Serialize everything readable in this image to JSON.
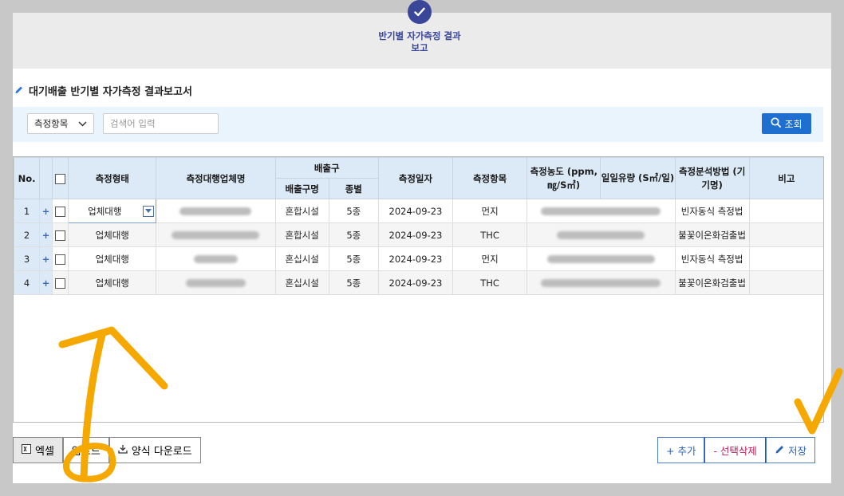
{
  "step": {
    "label": "반기별 자가측정 결과보고",
    "icon": "check-icon"
  },
  "section": {
    "title": "대기배출 반기별 자가측정 결과보고서",
    "icon": "pencil-icon"
  },
  "search": {
    "item_select_value": "측정항목",
    "placeholder": "검색어 입력",
    "button_label": "조회"
  },
  "table": {
    "headers": {
      "no": "No.",
      "type": "측정형태",
      "agency": "측정대행업체명",
      "outlet_group": "배출구",
      "outlet_name": "배출구명",
      "kind": "종별",
      "date": "측정일자",
      "item": "측정항목",
      "concentration": "측정농도 (ppm, ㎎/S㎥)",
      "flow": "일일유량 (S㎥/일)",
      "method": "측정분석방법 (기기명)",
      "remark": "비고"
    },
    "rows": [
      {
        "no": "1",
        "plus": "+",
        "type": "업체대행",
        "outlet_name": "혼합시설",
        "kind": "5종",
        "date": "2024-09-23",
        "item": "먼지",
        "method": "빈자동식 측정법",
        "remark": ""
      },
      {
        "no": "2",
        "plus": "+",
        "type": "업체대행",
        "outlet_name": "혼합시설",
        "kind": "5종",
        "date": "2024-09-23",
        "item": "THC",
        "method": "불꽃이온화검출법",
        "remark": ""
      },
      {
        "no": "3",
        "plus": "+",
        "type": "업체대행",
        "outlet_name": "혼십시설",
        "kind": "5종",
        "date": "2024-09-23",
        "item": "먼지",
        "method": "빈자동식 측정법",
        "remark": ""
      },
      {
        "no": "4",
        "plus": "+",
        "type": "업체대행",
        "outlet_name": "혼십시설",
        "kind": "5종",
        "date": "2024-09-23",
        "item": "THC",
        "method": "불꽃이온화검출법",
        "remark": ""
      }
    ]
  },
  "buttons": {
    "excel": "엑셀",
    "upload": "업로드",
    "template_download": "양식 다운로드",
    "add": "+ 추가",
    "delete_selected": "- 선택삭제",
    "save": "저장"
  },
  "colors": {
    "accent": "#1f6fd1",
    "step": "#3a4799",
    "delete": "#c2185b",
    "annotation": "#f5a800"
  }
}
